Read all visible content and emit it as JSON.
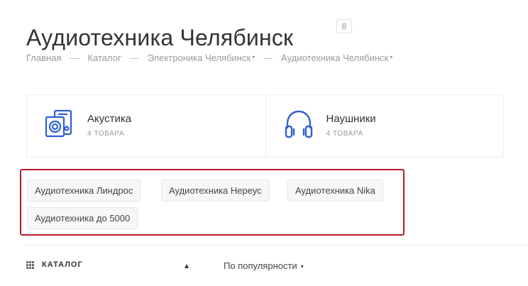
{
  "header": {
    "title": "Аудиотехника Челябинск",
    "count": "8"
  },
  "breadcrumb": {
    "items": [
      "Главная",
      "Каталог",
      "Электроника Челябинск",
      "Аудиотехника Челябинск"
    ],
    "separator": "—",
    "dropdown_caret": "▾"
  },
  "categories": [
    {
      "name": "Акустика",
      "count": "4 ТОВАРА",
      "icon": "speaker-icon"
    },
    {
      "name": "Наушники",
      "count": "4 ТОВАРА",
      "icon": "headphones-icon"
    }
  ],
  "tags": [
    "Аудиотехника Линдрос",
    "Аудиотехника Нереус",
    "Аудиотехника Nika",
    "Аудиотехника до 5000"
  ],
  "toolbar": {
    "catalog_label": "КАТАЛОГ",
    "collapse_icon": "▴",
    "sort_label": "По популярности",
    "sort_caret": "▾"
  },
  "colors": {
    "accent_icon": "#2f5fd0",
    "highlight_border": "#b41a2a"
  }
}
